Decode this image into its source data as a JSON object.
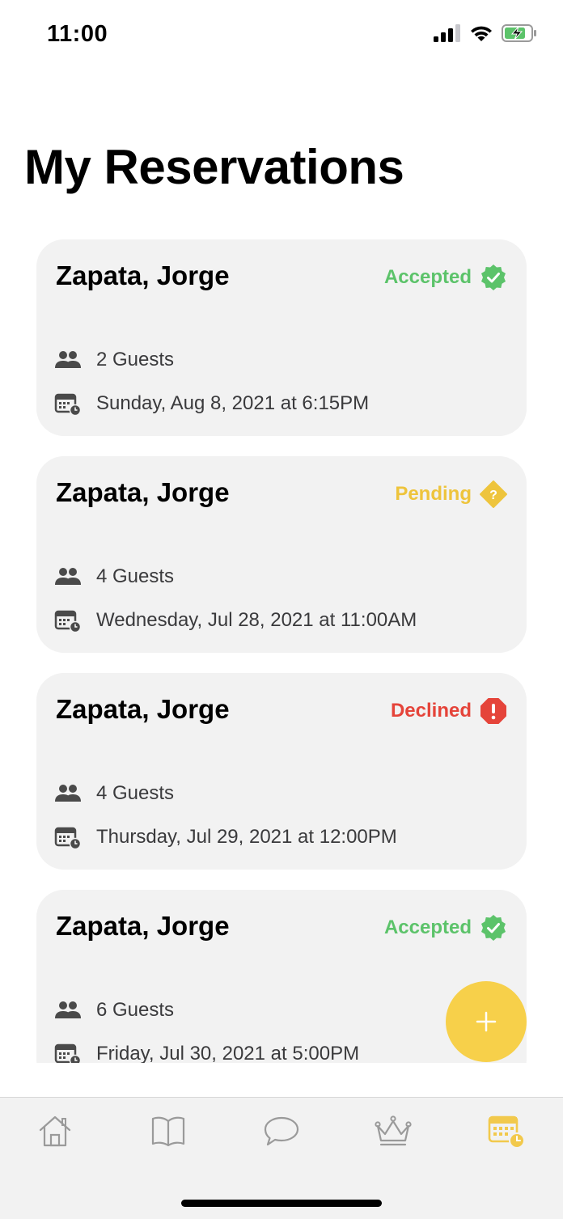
{
  "status_bar": {
    "time": "11:00",
    "icons": [
      "cellular-signal-icon",
      "wifi-icon",
      "battery-charging-icon"
    ]
  },
  "page": {
    "title": "My Reservations"
  },
  "colors": {
    "accepted": "#5cc36a",
    "pending": "#eec43c",
    "declined": "#e5443a",
    "accent": "#f7d04a",
    "card_background": "#f2f2f2"
  },
  "reservations": [
    {
      "name": "Zapata, Jorge",
      "status": "Accepted",
      "status_icon": "verified-check-icon",
      "guests": "2 Guests",
      "datetime": "Sunday, Aug 8, 2021 at 6:15PM"
    },
    {
      "name": "Zapata, Jorge",
      "status": "Pending",
      "status_icon": "question-diamond-icon",
      "guests": "4 Guests",
      "datetime": "Wednesday, Jul 28, 2021 at 11:00AM"
    },
    {
      "name": "Zapata, Jorge",
      "status": "Declined",
      "status_icon": "alert-octagon-icon",
      "guests": "4 Guests",
      "datetime": "Thursday, Jul 29, 2021 at 12:00PM"
    },
    {
      "name": "Zapata, Jorge",
      "status": "Accepted",
      "status_icon": "verified-check-icon",
      "guests": "6 Guests",
      "datetime": "Friday, Jul 30, 2021 at 5:00PM"
    }
  ],
  "fab": {
    "icon": "plus-icon"
  },
  "tab_bar": {
    "items": [
      {
        "icon": "home-icon",
        "active": false
      },
      {
        "icon": "menu-book-icon",
        "active": false
      },
      {
        "icon": "chat-bubble-icon",
        "active": false
      },
      {
        "icon": "crown-icon",
        "active": false
      },
      {
        "icon": "calendar-clock-icon",
        "active": true
      }
    ]
  }
}
